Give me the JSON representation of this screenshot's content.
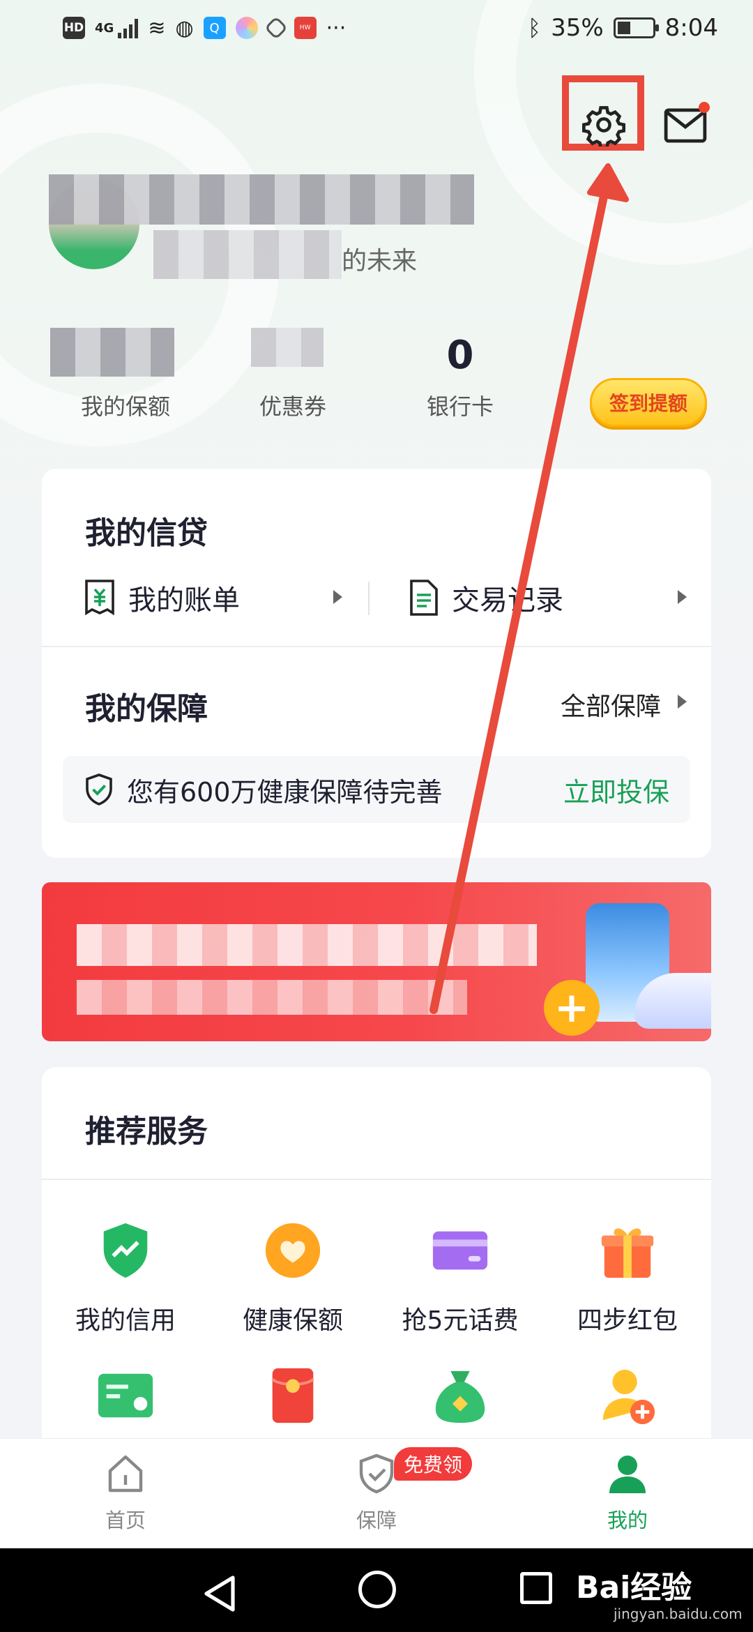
{
  "status_bar": {
    "network": "4G",
    "battery": "35%",
    "time": "8:04"
  },
  "header": {
    "settings_icon": "gear-icon",
    "mail_icon": "mail-icon",
    "has_unread": true
  },
  "profile": {
    "slogan": "的未来"
  },
  "stats": [
    {
      "value": "",
      "label": "我的保额"
    },
    {
      "value": "",
      "label": "优惠券"
    },
    {
      "value": "0",
      "label": "银行卡"
    }
  ],
  "checkin": {
    "label": "签到提额"
  },
  "credit_section": {
    "title": "我的信贷",
    "bill_label": "我的账单",
    "records_label": "交易记录"
  },
  "protection_section": {
    "title": "我的保障",
    "all_label": "全部保障",
    "notice_text": "您有600万健康保障待完善",
    "notice_cta": "立即投保"
  },
  "services": {
    "title": "推荐服务",
    "items": [
      {
        "label": "我的信用",
        "icon": "credit-shield-icon"
      },
      {
        "label": "健康保额",
        "icon": "heart-coin-icon"
      },
      {
        "label": "抢5元话费",
        "icon": "purple-card-icon"
      },
      {
        "label": "四步红包",
        "icon": "gift-box-icon"
      },
      {
        "label": "",
        "icon": "green-card-icon"
      },
      {
        "label": "",
        "icon": "red-envelope-icon"
      },
      {
        "label": "",
        "icon": "money-bag-icon"
      },
      {
        "label": "",
        "icon": "add-user-icon"
      }
    ]
  },
  "tabbar": {
    "tabs": [
      {
        "label": "首页",
        "icon": "home-icon"
      },
      {
        "label": "保障",
        "icon": "shield-check-icon",
        "badge": "免费领"
      },
      {
        "label": "我的",
        "icon": "person-icon"
      }
    ],
    "active": "我的"
  },
  "watermark": {
    "text": "Bai经验",
    "sub": "jingyan.baidu.com"
  },
  "colors": {
    "accent": "#18a058",
    "highlight": "#e84a3c"
  }
}
